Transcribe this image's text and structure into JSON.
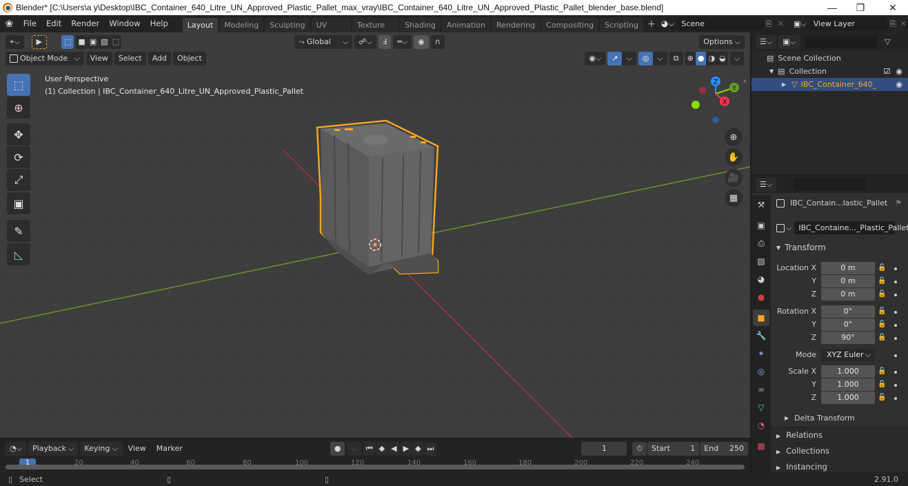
{
  "window": {
    "title": "Blender* [C:\\Users\\a y\\Desktop\\IBC_Container_640_Litre_UN_Approved_Plastic_Pallet_max_vray\\IBC_Container_640_Litre_UN_Approved_Plastic_Pallet_blender_base.blend]",
    "minimize": "—",
    "maximize": "❐",
    "close": "✕"
  },
  "menu": [
    "File",
    "Edit",
    "Render",
    "Window",
    "Help"
  ],
  "workspaces": [
    "Layout",
    "Modeling",
    "Sculpting",
    "UV Editing",
    "Texture Paint",
    "Shading",
    "Animation",
    "Rendering",
    "Compositing",
    "Scripting"
  ],
  "active_workspace": "Layout",
  "add_workspace": "+",
  "scene": {
    "value": "Scene"
  },
  "view_layer": {
    "value": "View Layer"
  },
  "viewport": {
    "transform_orientation": "Global",
    "options_label": "Options",
    "mode": "Object Mode",
    "menus": [
      "View",
      "Select",
      "Add",
      "Object"
    ],
    "overlay_title": "User Perspective",
    "overlay_subtitle": "(1) Collection | IBC_Container_640_Litre_UN_Approved_Plastic_Pallet",
    "gizmo": {
      "x": "X",
      "y": "Y",
      "z": "Z"
    },
    "tools": [
      "select-box",
      "cursor",
      "move",
      "rotate",
      "scale",
      "transform",
      "annotate",
      "measure"
    ],
    "nav_buttons": [
      "zoom",
      "pan",
      "camera",
      "ortho-grid"
    ]
  },
  "outliner": {
    "search_placeholder": "",
    "items": [
      {
        "label": "Scene Collection",
        "level": 0
      },
      {
        "label": "Collection",
        "level": 1,
        "checked": true
      },
      {
        "label": "IBC_Container_640_",
        "level": 2,
        "selected": true
      }
    ]
  },
  "properties": {
    "search_placeholder": "",
    "object_name_header": "IBC_Contain...lastic_Pallet",
    "object_name_field": "IBC_Containe..._Plastic_Pallet",
    "transform_label": "Transform",
    "location": {
      "label": "Location X",
      "x": "0 m",
      "y": "0 m",
      "z": "0 m"
    },
    "rotation": {
      "label": "Rotation X",
      "x": "0°",
      "y": "0°",
      "z": "90°"
    },
    "mode": {
      "label": "Mode",
      "value": "XYZ Euler"
    },
    "scale": {
      "label": "Scale X",
      "x": "1.000",
      "y": "1.000",
      "z": "1.000"
    },
    "axis_y": "Y",
    "axis_z": "Z",
    "delta_transform": "Delta Transform",
    "panels": [
      "Relations",
      "Collections",
      "Instancing"
    ]
  },
  "timeline": {
    "menus": [
      "Playback",
      "Keying",
      "View",
      "Marker"
    ],
    "current_frame": "1",
    "start_label": "Start",
    "start": "1",
    "end_label": "End",
    "end": "250",
    "ruler": [
      "20",
      "40",
      "60",
      "80",
      "100",
      "120",
      "140",
      "160",
      "180",
      "200",
      "220",
      "240"
    ],
    "playhead": "1"
  },
  "status": {
    "select": "Select",
    "version": "2.91.0"
  },
  "colors": {
    "accent_blue": "#4772b3",
    "selection_orange": "#f5a623",
    "axis_x": "#ff3352",
    "axis_y": "#8bdc00",
    "axis_z": "#2890ff"
  }
}
